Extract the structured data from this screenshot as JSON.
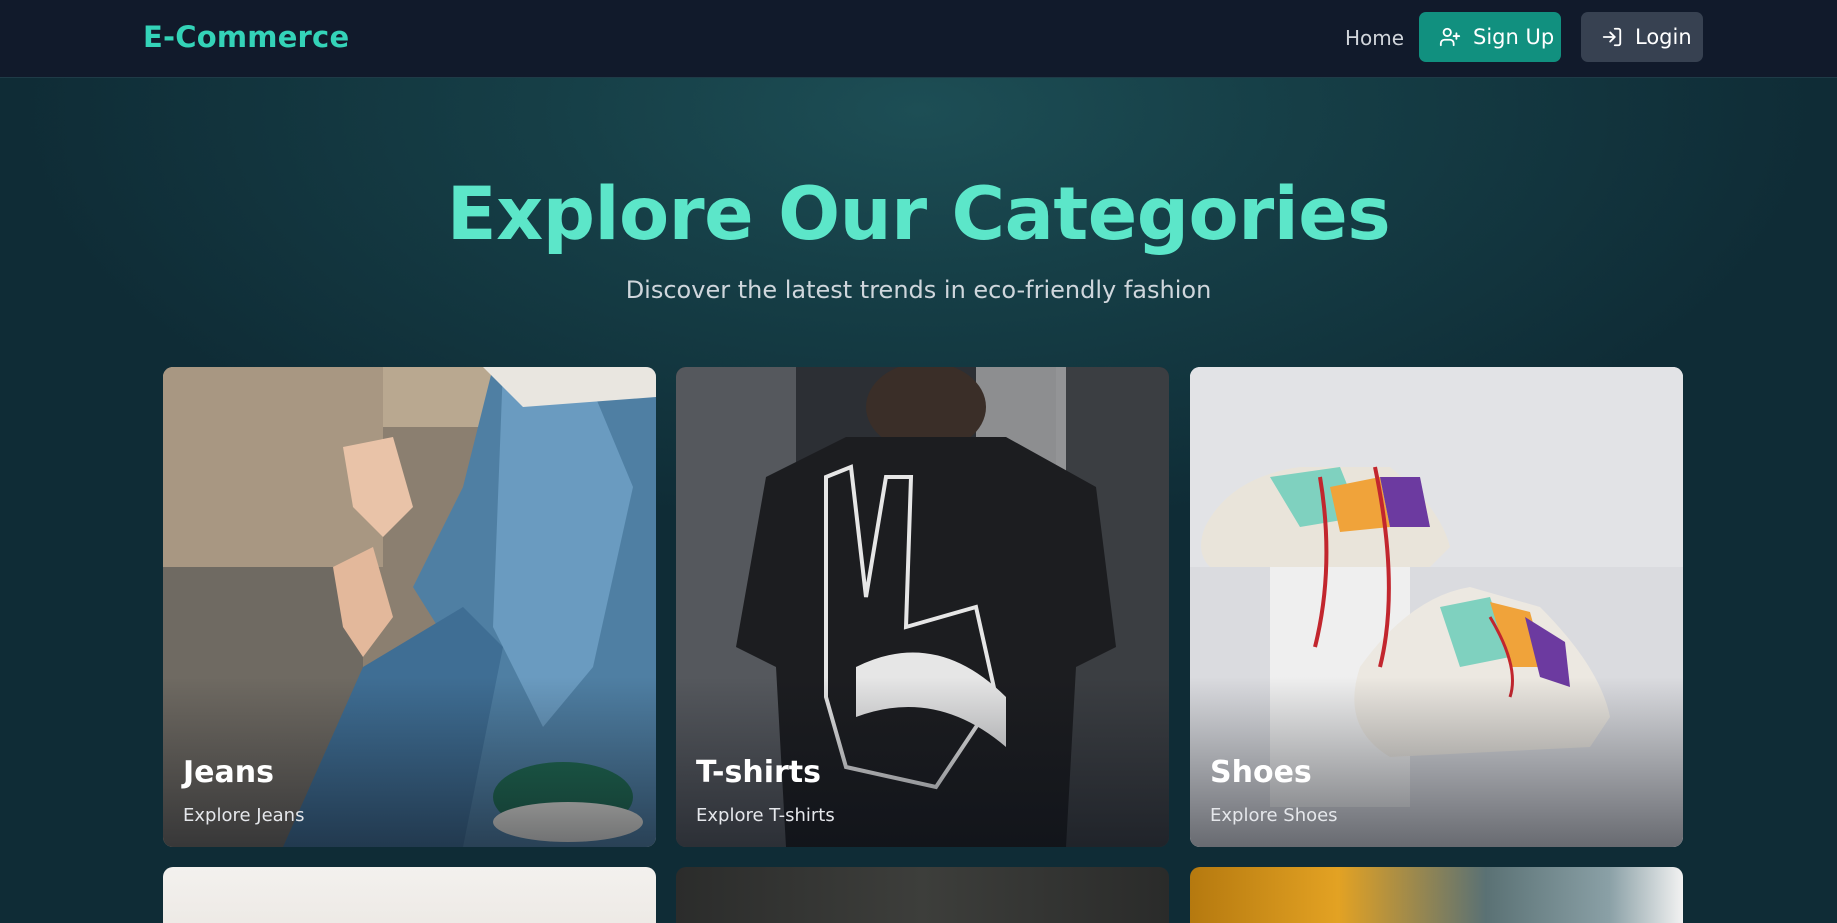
{
  "navbar": {
    "brand": "E-Commerce",
    "home_label": "Home",
    "signup_label": "Sign Up",
    "login_label": "Login",
    "signup_icon": "user-plus-icon",
    "login_icon": "log-in-icon"
  },
  "hero": {
    "title": "Explore Our Categories",
    "subtitle": "Discover the latest trends in eco-friendly fashion"
  },
  "categories": [
    {
      "title": "Jeans",
      "link": "Explore Jeans"
    },
    {
      "title": "T-shirts",
      "link": "Explore T-shirts"
    },
    {
      "title": "Shoes",
      "link": "Explore Shoes"
    }
  ],
  "colors": {
    "accent": "#34d3b8",
    "hero_title": "#5ce6c9",
    "signup_bg": "#11907f",
    "login_bg": "#374151",
    "navbar_bg": "#111a2b"
  }
}
